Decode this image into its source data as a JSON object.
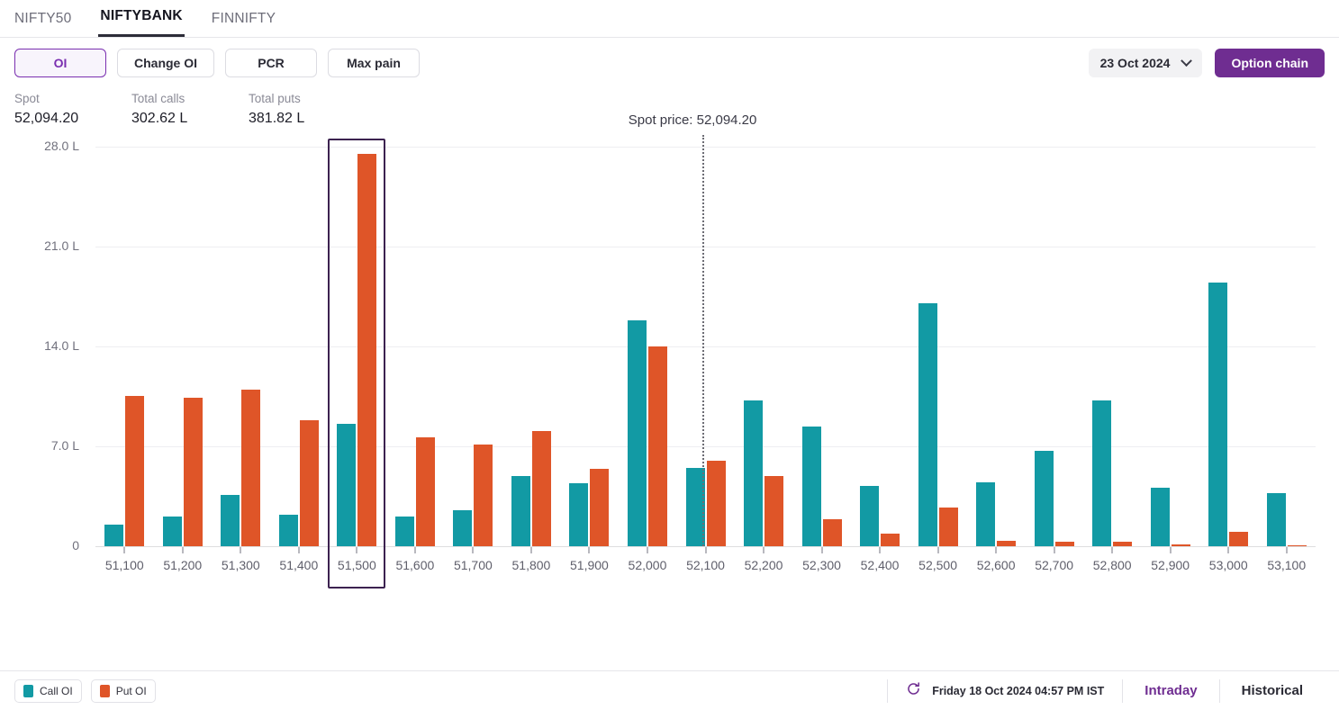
{
  "tabs": [
    {
      "label": "NIFTY50",
      "active": false
    },
    {
      "label": "NIFTYBANK",
      "active": true
    },
    {
      "label": "FINNIFTY",
      "active": false
    }
  ],
  "metric_buttons": [
    {
      "label": "OI",
      "selected": true
    },
    {
      "label": "Change OI",
      "selected": false
    },
    {
      "label": "PCR",
      "selected": false
    },
    {
      "label": "Max pain",
      "selected": false
    }
  ],
  "date_selector": {
    "value": "23 Oct 2024",
    "icon": "chevron-down-icon"
  },
  "option_chain_button": {
    "label": "Option chain"
  },
  "stats": [
    {
      "label": "Spot",
      "value": "52,094.20"
    },
    {
      "label": "Total calls",
      "value": "302.62 L"
    },
    {
      "label": "Total puts",
      "value": "381.82 L"
    }
  ],
  "footer": {
    "legend": [
      {
        "label": "Call OI",
        "color": "#129aa4"
      },
      {
        "label": "Put OI",
        "color": "#df5528"
      }
    ],
    "refresh_icon": "refresh-icon",
    "timestamp": "Friday 18 Oct 2024 04:57 PM IST",
    "links": [
      {
        "label": "Intraday",
        "active": true
      },
      {
        "label": "Historical",
        "active": false
      }
    ]
  },
  "chart_data": {
    "type": "bar",
    "title": "",
    "xlabel": "",
    "ylabel": "",
    "grid": true,
    "legend_position": "bottom-left",
    "ylim": [
      0,
      30
    ],
    "yticks": [
      "0",
      "7.0 L",
      "14.0 L",
      "21.0 L",
      "28.0 L"
    ],
    "ytick_values": [
      0,
      7,
      14,
      21,
      28
    ],
    "categories": [
      "51,100",
      "51,200",
      "51,300",
      "51,400",
      "51,500",
      "51,600",
      "51,700",
      "51,800",
      "51,900",
      "52,000",
      "52,100",
      "52,200",
      "52,300",
      "52,400",
      "52,500",
      "52,600",
      "52,700",
      "52,800",
      "52,900",
      "53,000",
      "53,100"
    ],
    "series": [
      {
        "name": "Call OI",
        "color": "#129aa4",
        "values": [
          1.5,
          2.1,
          3.6,
          2.2,
          8.6,
          2.1,
          2.5,
          4.9,
          4.4,
          15.8,
          5.5,
          10.2,
          8.4,
          4.2,
          17.0,
          4.5,
          6.7,
          10.2,
          4.1,
          18.5,
          3.7
        ]
      },
      {
        "name": "Put OI",
        "color": "#df5528",
        "values": [
          10.5,
          10.4,
          11.0,
          8.8,
          27.5,
          7.6,
          7.1,
          8.1,
          5.4,
          14.0,
          6.0,
          4.9,
          1.9,
          0.9,
          2.7,
          0.4,
          0.3,
          0.3,
          0.1,
          1.0,
          0.05
        ]
      }
    ],
    "annotations": {
      "spot_line": {
        "label": "Spot price: 52,094.20",
        "value": 52094.2,
        "style": "dotted"
      },
      "selection": {
        "strike": "51,500"
      }
    }
  }
}
